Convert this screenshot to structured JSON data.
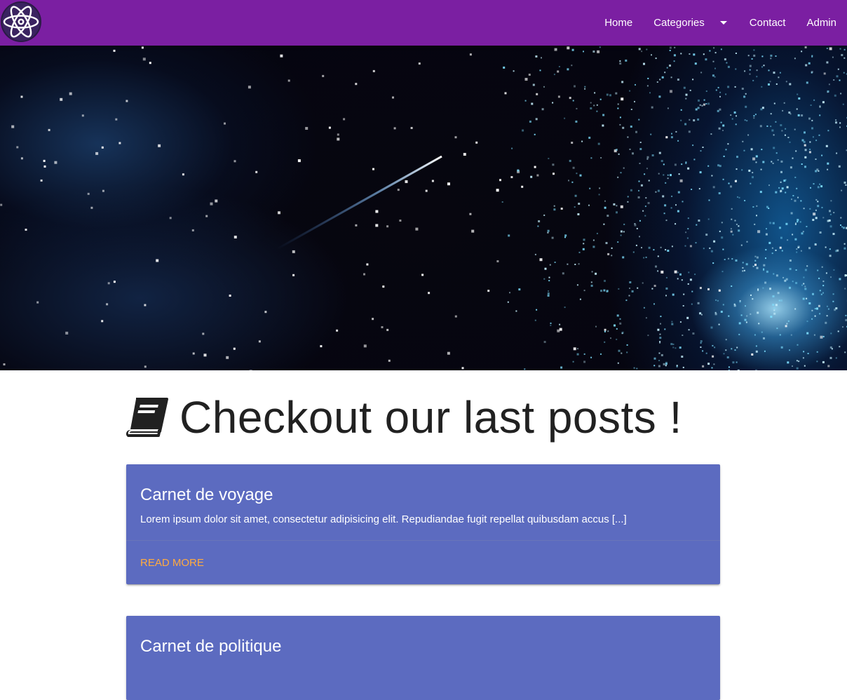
{
  "navbar": {
    "logo": "atom-logo",
    "bg_color": "#7b1fa2",
    "links": [
      {
        "label": "Home"
      },
      {
        "label": "Categories",
        "has_dropdown": true
      },
      {
        "label": "Contact"
      },
      {
        "label": "Admin"
      }
    ]
  },
  "hero": {
    "image": "starry-night-sky-with-shooting-star"
  },
  "section": {
    "icon": "book-icon",
    "title": "Checkout our last posts !"
  },
  "posts": [
    {
      "title": "Carnet de voyage",
      "excerpt": "Lorem ipsum dolor sit amet, consectetur adipisicing elit. Repudiandae fugit repellat quibusdam accus [...]",
      "action": "Read More"
    },
    {
      "title": "Carnet de politique",
      "excerpt": "",
      "action": ""
    }
  ],
  "colors": {
    "card": "#5c6bc0",
    "accent": "#ffab40"
  }
}
